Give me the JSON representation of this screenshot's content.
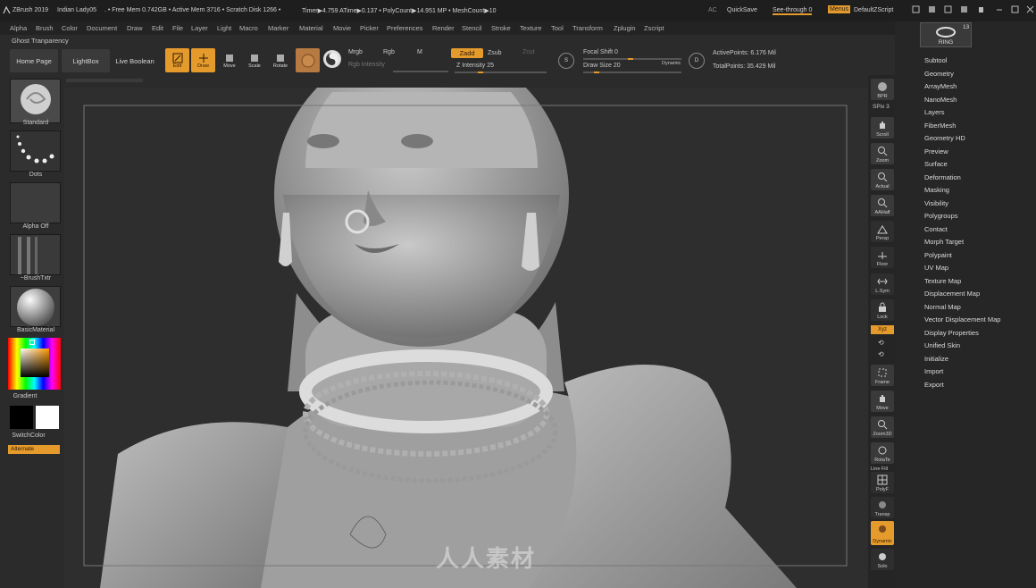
{
  "titlebar": {
    "app": "ZBrush 2019",
    "document": "Indian Lady05",
    "stats": ". • Free Mem 0.742GB • Active Mem 3716 • Scratch Disk 1266 •",
    "timer": "Timer▶4.759 ATime▶0.137 • PolyCount▶14.951 MP • MeshCount▶10",
    "ac": "AC",
    "quicksave": "QuickSave",
    "see_through": "See-through  0",
    "menus": "Menus",
    "script": "DefaultZScript"
  },
  "menubar": [
    "Alpha",
    "Brush",
    "Color",
    "Document",
    "Draw",
    "Edit",
    "File",
    "Layer",
    "Light",
    "Macro",
    "Marker",
    "Material",
    "Movie",
    "Picker",
    "Preferences",
    "Render",
    "Stencil",
    "Stroke",
    "Texture",
    "Tool",
    "Transform",
    "Zplugin",
    "Zscript"
  ],
  "ghost": "Ghost Tranparency",
  "toolbar": {
    "home": "Home Page",
    "lightbox": "LightBox",
    "live_boolean": "Live Boolean",
    "edit": "Edit",
    "draw": "Draw",
    "move": "Move",
    "scale": "Scale",
    "rotate": "Rotate",
    "mrgb": "Mrgb",
    "rgb": "Rgb",
    "m": "M",
    "rgb_intensity": "Rgb Intensity",
    "zadd": "Zadd",
    "zsub": "Zsub",
    "zcut": "Zcut",
    "z_intensity": "Z Intensity 25",
    "z_intensity_value": 0.25,
    "focal_shift": "Focal Shift 0",
    "draw_size": "Draw Size 20",
    "dynamic": "Dynamic",
    "active_points": "ActivePoints: 6.176 Mil",
    "total_points": "TotalPoints: 35.429 Mil"
  },
  "leftpanel": {
    "brush": "Standard",
    "stroke": "Dots",
    "alpha": "Alpha Off",
    "texture": "~BrushTxtr",
    "material": "BasicMaterial",
    "gradient": "Gradient",
    "switchcolor": "SwitchColor",
    "alternate": "Alternate"
  },
  "rightstrip": [
    {
      "name": "bpr",
      "label": "BPR"
    },
    {
      "name": "spix",
      "label": "SPix 3"
    },
    {
      "name": "scroll",
      "label": "Scroll"
    },
    {
      "name": "zoom",
      "label": "Zoom"
    },
    {
      "name": "actual",
      "label": "Actual"
    },
    {
      "name": "aahalf",
      "label": "AAHalf"
    },
    {
      "name": "persp",
      "label": "Persp"
    },
    {
      "name": "floor",
      "label": "Floor"
    },
    {
      "name": "lsym",
      "label": "L.Sym"
    },
    {
      "name": "lock",
      "label": "Lock"
    },
    {
      "name": "xyz",
      "label": "Xyz"
    },
    {
      "name": "frame",
      "label": "Frame"
    },
    {
      "name": "move",
      "label": "Move"
    },
    {
      "name": "zoom3d",
      "label": "Zoom3D"
    },
    {
      "name": "rotate",
      "label": "RotaTe"
    },
    {
      "name": "linefill",
      "label": "Line Fill"
    },
    {
      "name": "polyf",
      "label": "PolyF"
    },
    {
      "name": "transp",
      "label": "Transp"
    },
    {
      "name": "dynamic",
      "label": "Dynamic"
    },
    {
      "name": "solo",
      "label": "Solo"
    }
  ],
  "tool": {
    "name": "RING",
    "count": "13"
  },
  "rightpanel": [
    "Subtool",
    "Geometry",
    "ArrayMesh",
    "NanoMesh",
    "Layers",
    "FiberMesh",
    "Geometry HD",
    "Preview",
    "Surface",
    "Deformation",
    "Masking",
    "Visibility",
    "Polygroups",
    "Contact",
    "Morph Target",
    "Polypaint",
    "UV Map",
    "Texture Map",
    "Displacement Map",
    "Normal Map",
    "Vector Displacement Map",
    "Display Properties",
    "Unified Skin",
    "Initialize",
    "Import",
    "Export"
  ],
  "watermark": "人人素材",
  "colors": {
    "accent": "#e59a2c",
    "panel": "#2b2b2b",
    "viewport": "#2e2e2e"
  }
}
